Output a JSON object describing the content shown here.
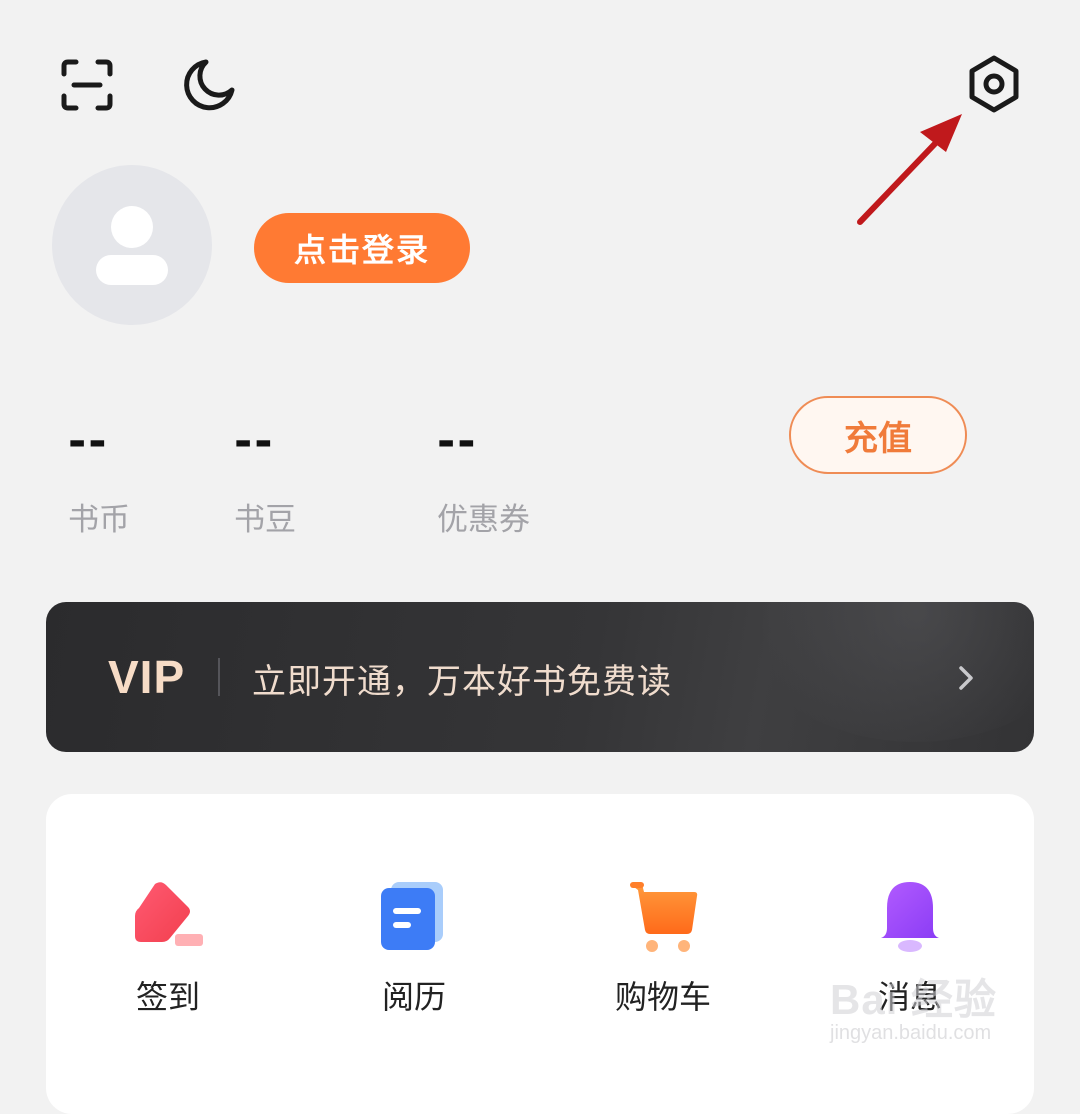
{
  "header": {
    "icons": [
      "scan-icon",
      "moon-icon",
      "gear-icon"
    ]
  },
  "profile": {
    "login_label": "点击登录"
  },
  "stats": {
    "items": [
      {
        "value": "--",
        "label": "书币"
      },
      {
        "value": "--",
        "label": "书豆"
      },
      {
        "value": "--",
        "label": "优惠券"
      }
    ],
    "recharge_label": "充值"
  },
  "vip": {
    "logo": "VIP",
    "text": "立即开通，万本好书免费读"
  },
  "features": [
    {
      "label": "签到",
      "icon": "pencil-icon"
    },
    {
      "label": "阅历",
      "icon": "document-icon"
    },
    {
      "label": "购物车",
      "icon": "cart-icon"
    },
    {
      "label": "消息",
      "icon": "bell-icon"
    }
  ],
  "watermark": {
    "brand": "Bai 经验",
    "url": "jingyan.baidu.com"
  },
  "colors": {
    "accent": "#ff7a33",
    "background": "#f2f2f2",
    "vip_bg": "#2e2e30",
    "vip_text": "#f7dcc6",
    "annotation_arrow": "#c0191c"
  }
}
